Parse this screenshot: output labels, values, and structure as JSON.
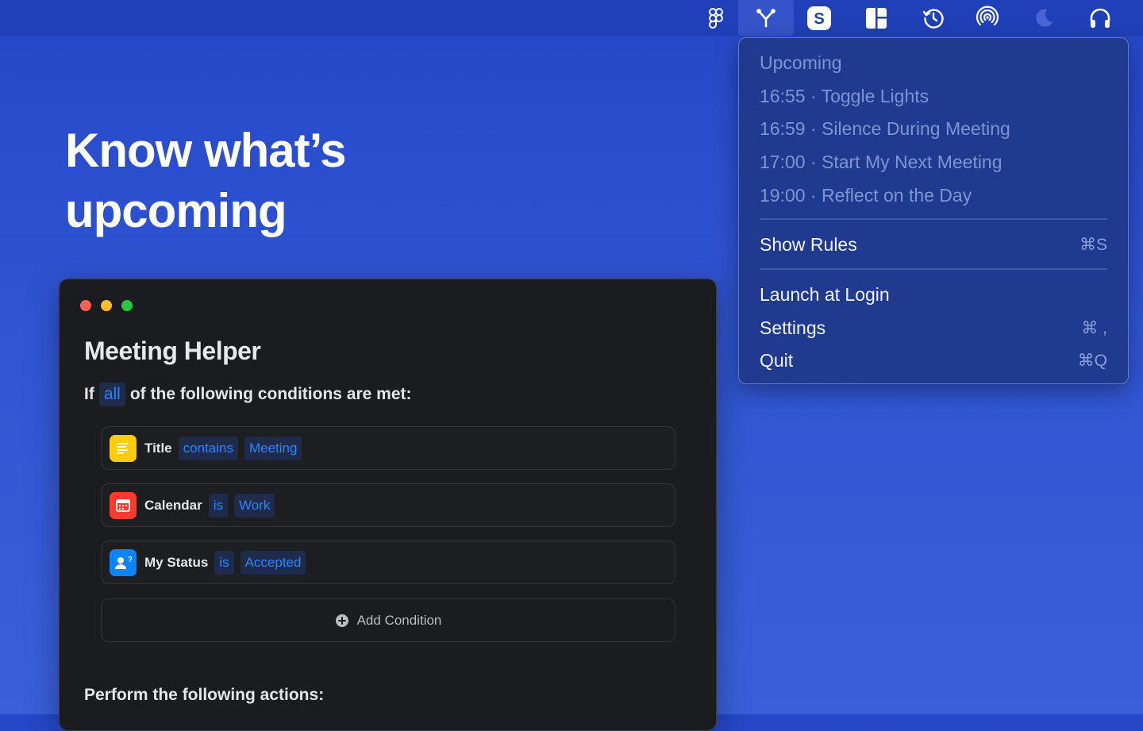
{
  "menubar": {
    "icons": [
      "figma-icon",
      "split-y-icon",
      "s-badge-icon",
      "layout-icon",
      "history-clock-icon",
      "airdrop-icon",
      "moon-icon",
      "headphones-icon"
    ],
    "active_icon": "split-y-icon"
  },
  "headline": {
    "line1": "Know what’s",
    "line2": "upcoming"
  },
  "window": {
    "title": "Meeting Helper",
    "condition_prefix": "If",
    "condition_quantifier": "all",
    "condition_suffix": "of the following conditions are met:",
    "conditions": [
      {
        "icon": "notes-icon",
        "label": "Title",
        "operator": "contains",
        "value": "Meeting"
      },
      {
        "icon": "calendar-icon",
        "label": "Calendar",
        "operator": "is",
        "value": "Work"
      },
      {
        "icon": "person-status-icon",
        "label": "My Status",
        "operator": "is",
        "value": "Accepted"
      }
    ],
    "add_condition_label": "Add Condition",
    "actions_heading": "Perform the following actions:"
  },
  "menu": {
    "upcoming_header": "Upcoming",
    "upcoming": [
      "16:55 · Toggle Lights",
      "16:59 · Silence During Meeting",
      "17:00 · Start My Next Meeting",
      "19:00 · Reflect on the Day"
    ],
    "show_rules": {
      "label": "Show Rules",
      "shortcut": "⌘S"
    },
    "launch_at_login": {
      "label": "Launch at Login"
    },
    "settings": {
      "label": "Settings",
      "shortcut": "⌘ ,"
    },
    "quit": {
      "label": "Quit",
      "shortcut": "⌘Q"
    }
  },
  "colors": {
    "background": "#2f55d3",
    "window": "#1b1c20",
    "accent": "#2d83ff",
    "menu": "#1f3a8f"
  }
}
